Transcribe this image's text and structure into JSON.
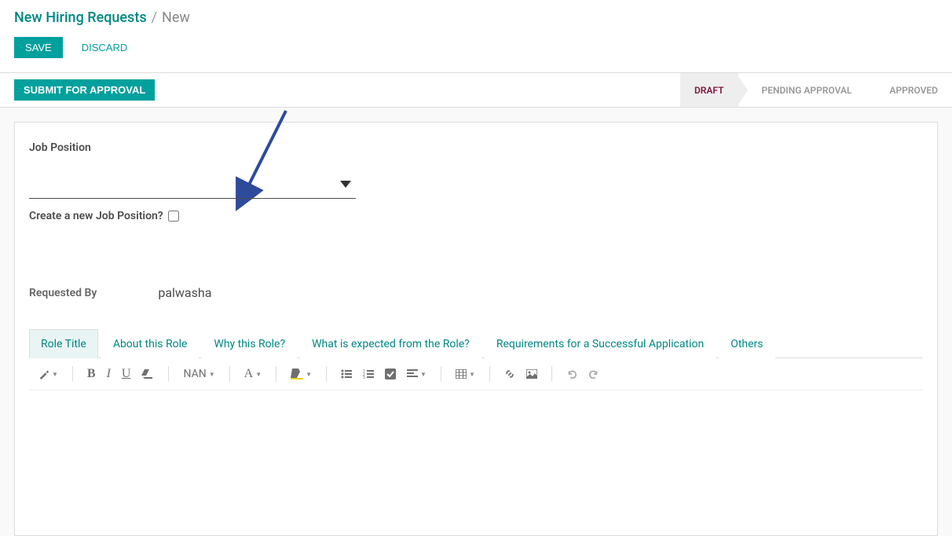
{
  "breadcrumb": {
    "root": "New Hiring Requests",
    "separator": "/",
    "current": "New"
  },
  "actions": {
    "save": "SAVE",
    "discard": "DISCARD"
  },
  "statusBar": {
    "submit": "SUBMIT FOR APPROVAL",
    "stages": [
      "DRAFT",
      "PENDING APPROVAL",
      "APPROVED"
    ],
    "activeStageIndex": 0
  },
  "form": {
    "jobPositionLabel": "Job Position",
    "jobPositionValue": "",
    "createNewLabel": "Create a new Job Position?",
    "createNewChecked": false,
    "requestedByLabel": "Requested By",
    "requestedByValue": "palwasha"
  },
  "tabs": [
    {
      "key": "role-title",
      "label": "Role Title",
      "active": true
    },
    {
      "key": "about-role",
      "label": "About this Role",
      "active": false
    },
    {
      "key": "why-role",
      "label": "Why this Role?",
      "active": false
    },
    {
      "key": "expected",
      "label": "What is expected from the Role?",
      "active": false
    },
    {
      "key": "requirements",
      "label": "Requirements for a Successful Application",
      "active": false
    },
    {
      "key": "others",
      "label": "Others",
      "active": false
    }
  ],
  "editor": {
    "fontSizeLabel": "NAN"
  }
}
